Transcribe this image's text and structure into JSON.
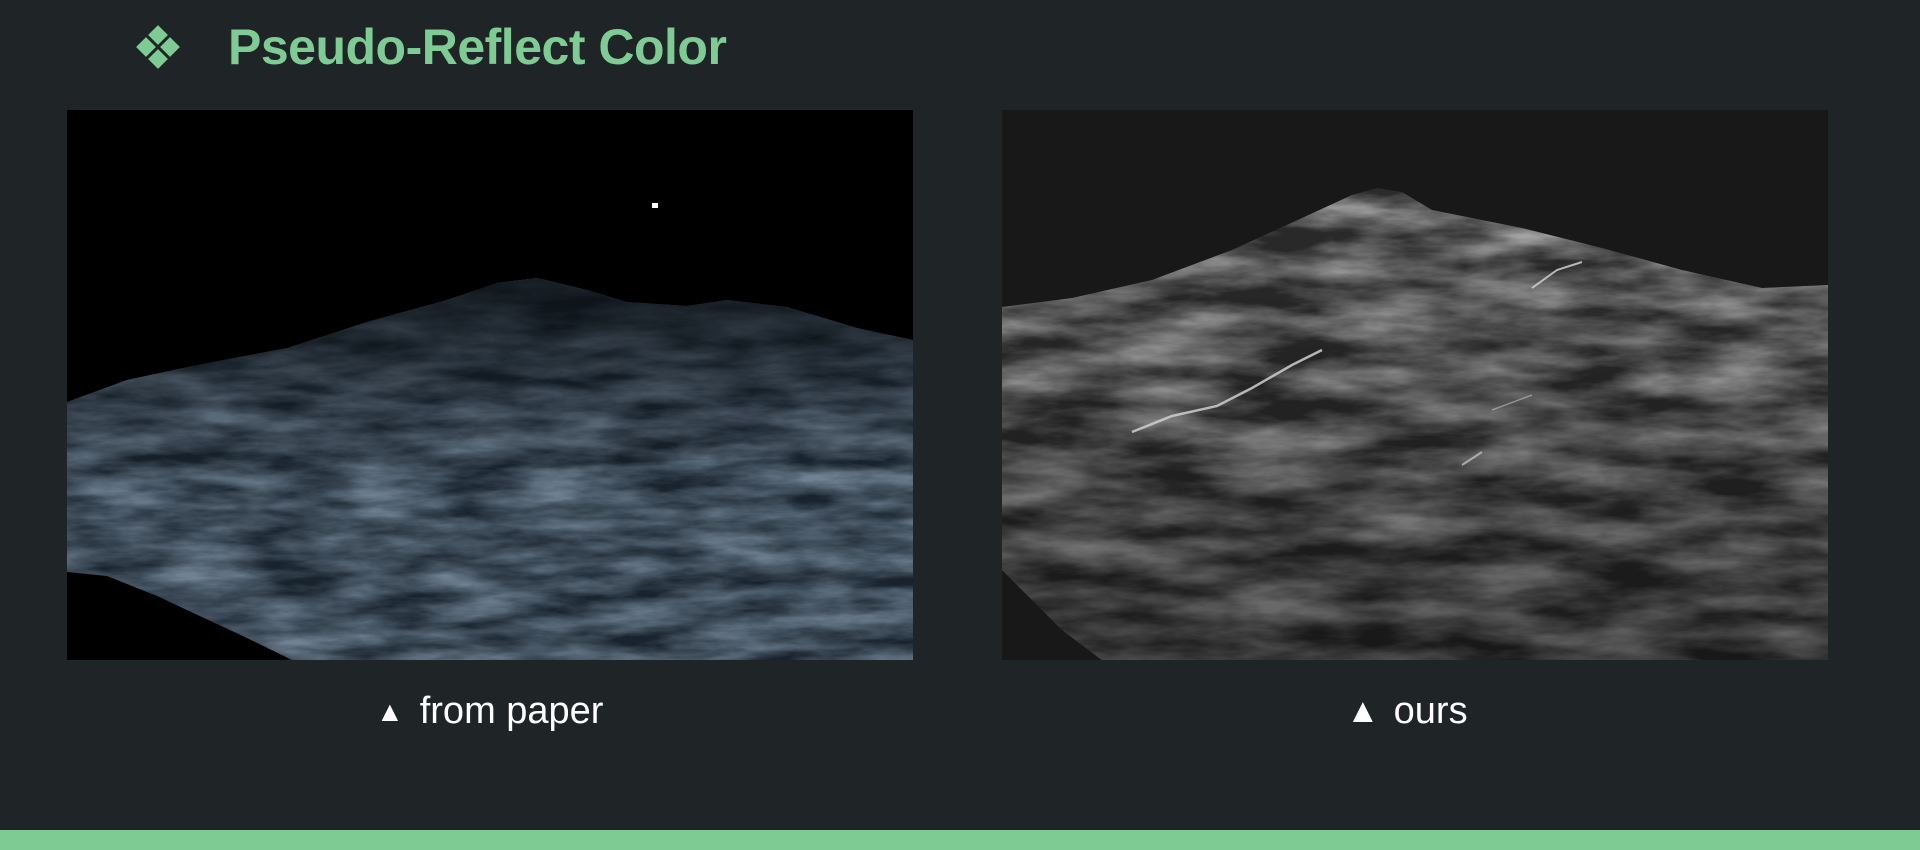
{
  "colors": {
    "accent": "#7ecb94",
    "background": "#1f2427",
    "caption_text": "#ffffff"
  },
  "header": {
    "bullet_icon": "diamond-cluster-icon",
    "title": "Pseudo-Reflect Color"
  },
  "panels": [
    {
      "image": "ocean-render-paper",
      "caption_icon": "triangle-up-icon",
      "caption_marker": "▲",
      "caption": "from paper"
    },
    {
      "image": "ocean-render-ours",
      "caption_icon": "triangle-up-icon",
      "caption_marker": "▲",
      "caption": "ours"
    }
  ]
}
